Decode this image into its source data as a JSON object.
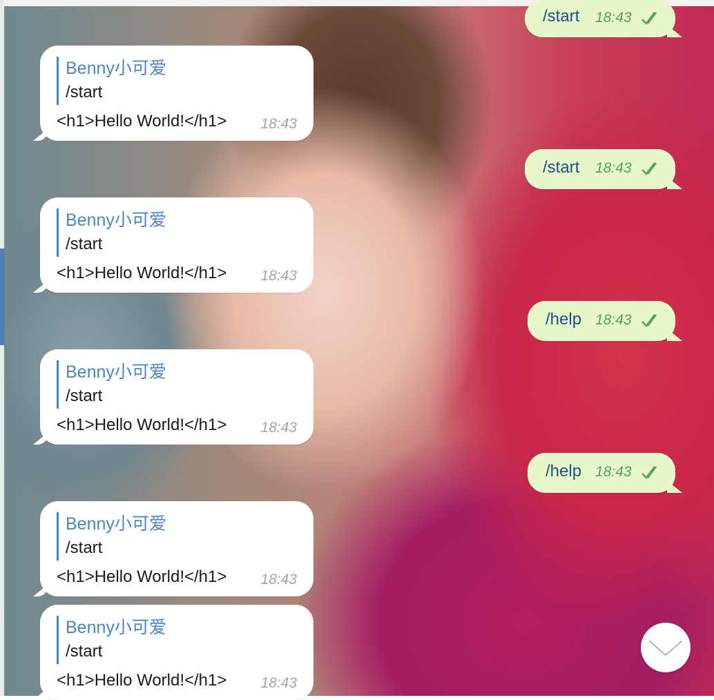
{
  "incoming": [
    {
      "reply_name": "Benny小可爱",
      "reply_text": "/start",
      "body": "<h1>Hello World!</h1>",
      "time": "18:43"
    },
    {
      "reply_name": "Benny小可爱",
      "reply_text": "/start",
      "body": "<h1>Hello World!</h1>",
      "time": "18:43"
    },
    {
      "reply_name": "Benny小可爱",
      "reply_text": "/start",
      "body": "<h1>Hello World!</h1>",
      "time": "18:43"
    },
    {
      "reply_name": "Benny小可爱",
      "reply_text": "/start",
      "body": "<h1>Hello World!</h1>",
      "time": "18:43"
    },
    {
      "reply_name": "Benny小可爱",
      "reply_text": "/start",
      "body": "<h1>Hello World!</h1>",
      "time": "18:43"
    }
  ],
  "outgoing": [
    {
      "text": "/start",
      "time": "18:43",
      "status": "double-check-icon"
    },
    {
      "text": "/start",
      "time": "18:43",
      "status": "double-check-icon"
    },
    {
      "text": "/help",
      "time": "18:43",
      "status": "double-check-icon"
    },
    {
      "text": "/help",
      "time": "18:43",
      "status": "double-check-icon"
    }
  ],
  "colors": {
    "reply_accent": "#4a86c7",
    "outgoing_bubble": "#e6f7ca",
    "outgoing_text": "#1f4f86",
    "outgoing_time": "#56a05b",
    "incoming_time": "#a3a3a3"
  },
  "scroll_button": {
    "icon": "chevron-down-icon"
  }
}
